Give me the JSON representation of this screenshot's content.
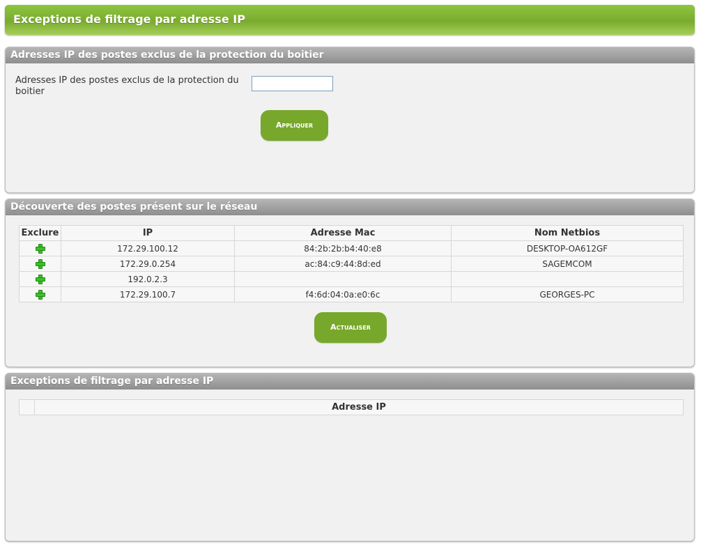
{
  "page_title": "Exceptions de filtrage par adresse IP",
  "excluded_panel": {
    "title": "Adresses IP des postes exclus de la protection du boitier",
    "field_label": "Adresses IP des postes exclus de la protection du boitier",
    "field_value": "",
    "apply_label": "Appliquer"
  },
  "discovery_panel": {
    "title": "Découverte des postes présent sur le réseau",
    "columns": [
      "Exclure",
      "IP",
      "Adresse Mac",
      "Nom Netbios"
    ],
    "rows": [
      {
        "ip": "172.29.100.12",
        "mac": "84:2b:2b:b4:40:e8",
        "netbios": "DESKTOP-OA612GF"
      },
      {
        "ip": "172.29.0.254",
        "mac": "ac:84:c9:44:8d:ed",
        "netbios": "SAGEMCOM"
      },
      {
        "ip": "192.0.2.3",
        "mac": "",
        "netbios": ""
      },
      {
        "ip": "172.29.100.7",
        "mac": "f4:6d:04:0a:e0:6c",
        "netbios": "GEORGES-PC"
      }
    ],
    "exclude_icon": "plus-icon",
    "refresh_label": "Actualiser"
  },
  "exceptions_panel": {
    "title": "Exceptions de filtrage par adresse IP",
    "columns": [
      "",
      "Adresse IP"
    ]
  },
  "colors": {
    "accent_green": "#78a82b",
    "header_grey": "#9e9e9e",
    "plus_green": "#3cbf2a"
  }
}
